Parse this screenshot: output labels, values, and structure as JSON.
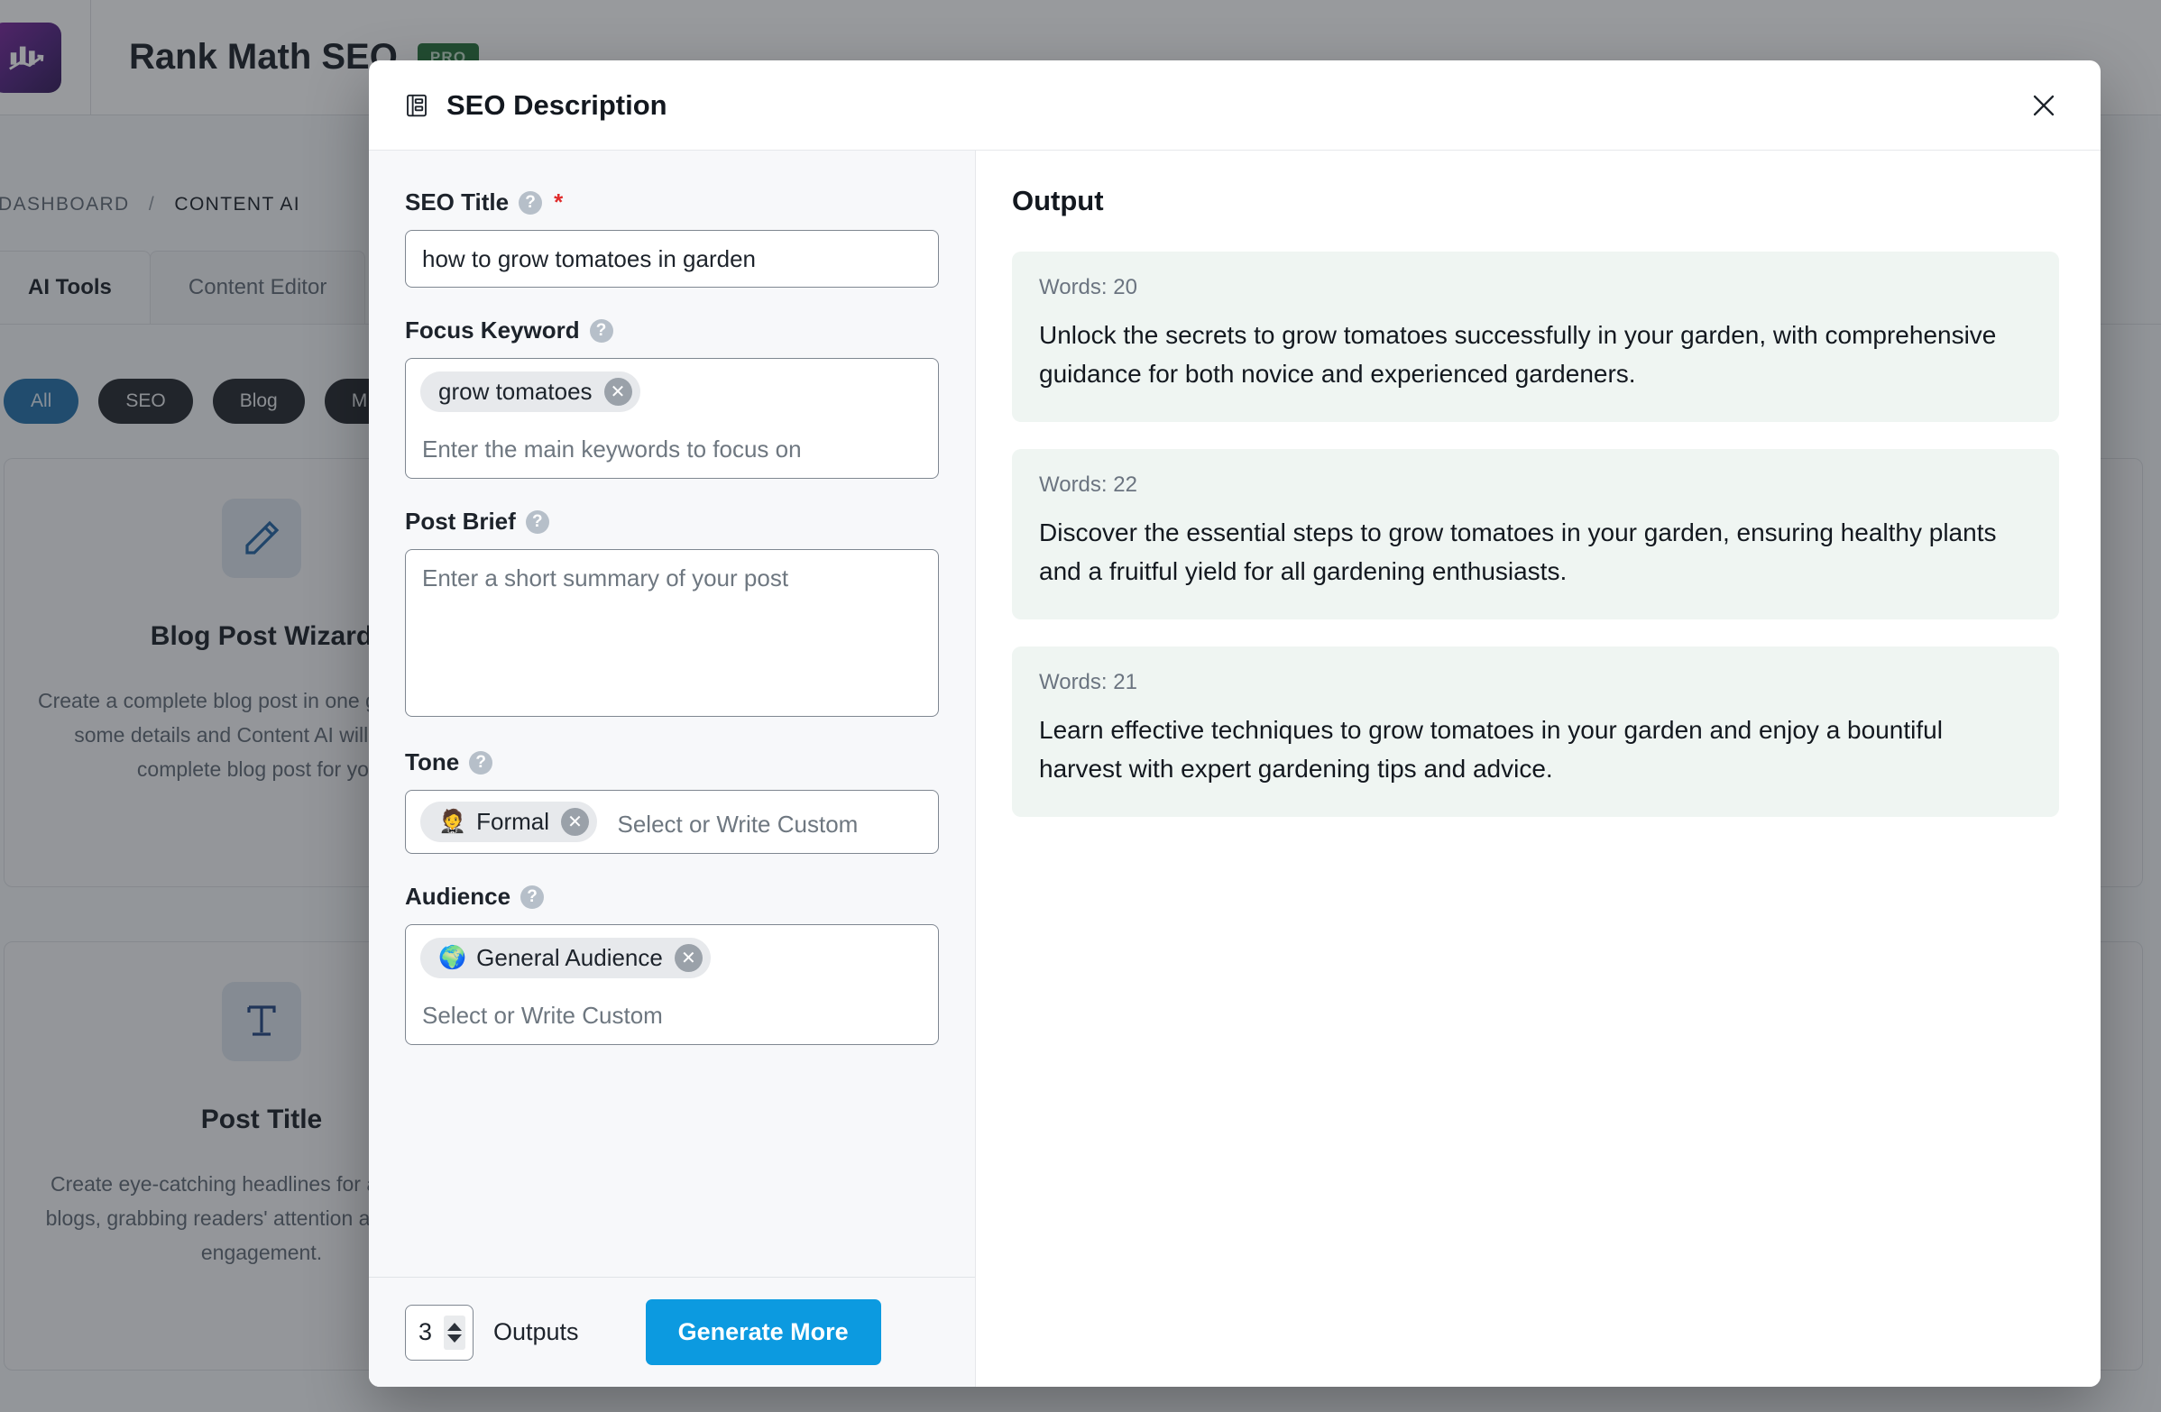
{
  "background": {
    "app_title": "Rank Math SEO",
    "pro_badge": "PRO",
    "logo_icon": "bar-chart-logo-icon",
    "breadcrumb": {
      "root": "DASHBOARD",
      "separator": "/",
      "current": "CONTENT AI"
    },
    "tabs": [
      {
        "label": "AI Tools",
        "active": true
      },
      {
        "label": "Content Editor",
        "active": false
      }
    ],
    "filter_pills": [
      {
        "label": "All",
        "active": true
      },
      {
        "label": "SEO",
        "active": false
      },
      {
        "label": "Blog",
        "active": false
      },
      {
        "label": "M",
        "active": false
      }
    ],
    "cards": [
      {
        "icon": "pencil-icon",
        "title": "Blog Post Wizard",
        "desc": "Create a complete blog post in one go. Just fill in some details and Content AI will create a complete blog post for you."
      },
      {
        "icon": "title-icon",
        "title": "Post Title",
        "desc": "Create eye-catching headlines for articles and blogs, grabbing readers' attention and boosting engagement."
      }
    ]
  },
  "modal": {
    "title": "SEO Description",
    "title_icon": "document-list-icon",
    "close_icon": "close-icon",
    "form": {
      "seo_title": {
        "label": "SEO Title",
        "help_icon": "question-mark-icon",
        "required_marker": "*",
        "value": "how to grow tomatoes in garden",
        "placeholder": ""
      },
      "focus_keyword": {
        "label": "Focus Keyword",
        "help_icon": "question-mark-icon",
        "chips": [
          {
            "label": "grow tomatoes",
            "emoji": ""
          }
        ],
        "placeholder": "Enter the main keywords to focus on"
      },
      "post_brief": {
        "label": "Post Brief",
        "help_icon": "question-mark-icon",
        "value": "",
        "placeholder": "Enter a short summary of your post"
      },
      "tone": {
        "label": "Tone",
        "help_icon": "question-mark-icon",
        "chips": [
          {
            "label": "Formal",
            "emoji": "🤵"
          }
        ],
        "placeholder": "Select or Write Custom"
      },
      "audience": {
        "label": "Audience",
        "help_icon": "question-mark-icon",
        "chips": [
          {
            "label": "General Audience",
            "emoji": "🌍"
          }
        ],
        "placeholder": "Select or Write Custom"
      }
    },
    "footer": {
      "outputs_value": "3",
      "outputs_label": "Outputs",
      "generate_button": "Generate More"
    },
    "output": {
      "heading": "Output",
      "results": [
        {
          "words_label": "Words: 20",
          "text": "Unlock the secrets to grow tomatoes successfully in your garden, with comprehensive guidance for both novice and experienced gardeners."
        },
        {
          "words_label": "Words: 22",
          "text": "Discover the essential steps to grow tomatoes in your garden, ensuring healthy plants and a fruitful yield for all gardening enthusiasts."
        },
        {
          "words_label": "Words: 21",
          "text": "Learn effective techniques to grow tomatoes in your garden and enjoy a bountiful harvest with expert gardening tips and advice."
        }
      ]
    }
  },
  "colors": {
    "accent_blue": "#0c9ae0",
    "pro_green": "#1d6b33",
    "output_card_bg": "#eff5f2",
    "required_red": "#e02b2b"
  }
}
